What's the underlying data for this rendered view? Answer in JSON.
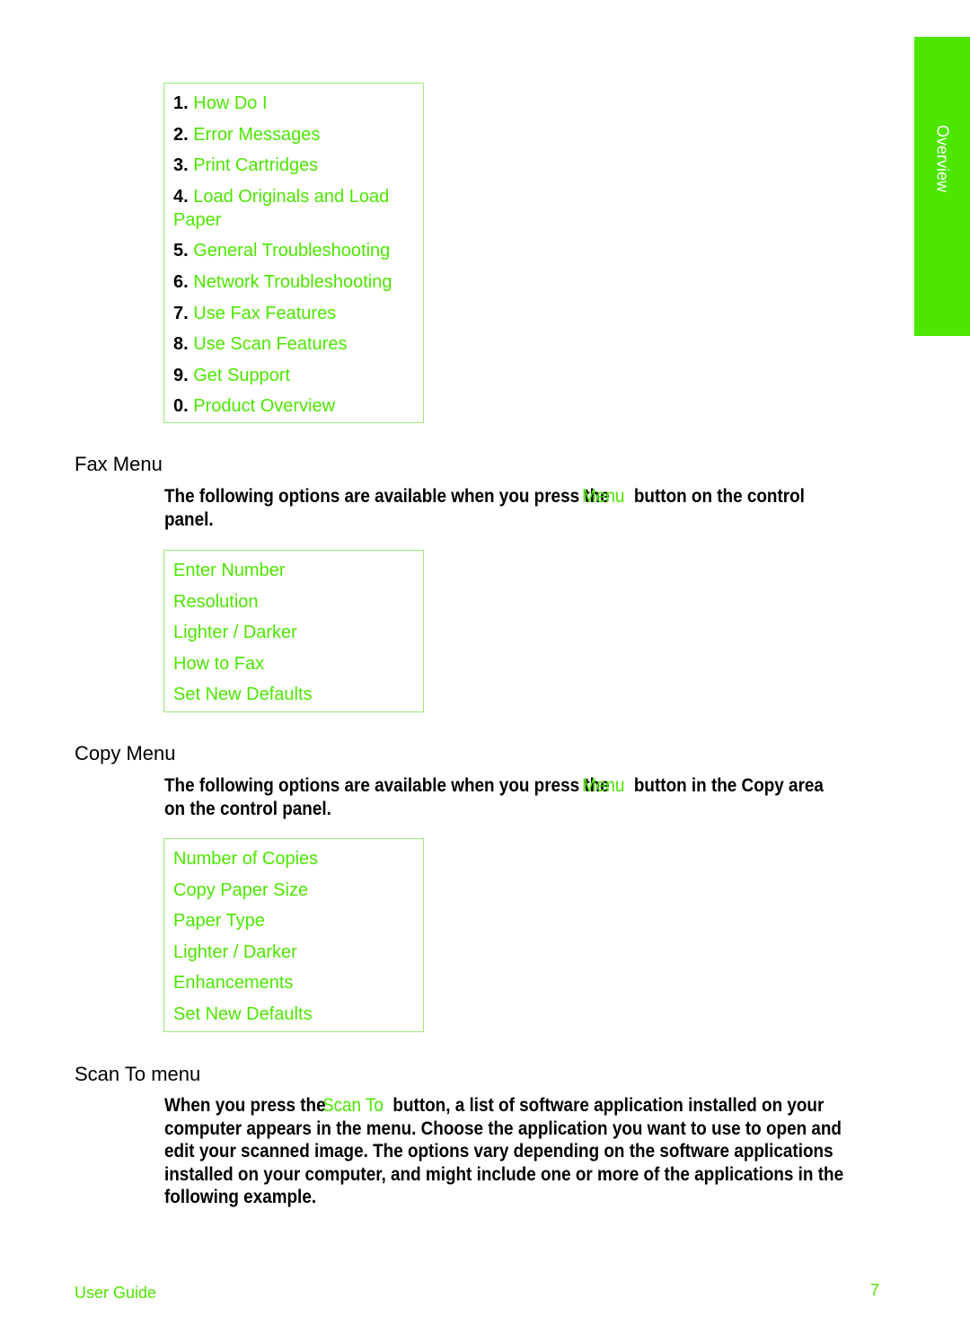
{
  "side_tab": {
    "label": "Overview"
  },
  "contents_menu": {
    "items": [
      {
        "num": "1.",
        "label": "How Do I"
      },
      {
        "num": "2.",
        "label": "Error Messages"
      },
      {
        "num": "3.",
        "label": "Print Cartridges"
      },
      {
        "num": "4.",
        "label": "Load Originals and Load Paper"
      },
      {
        "num": "5.",
        "label": "General Troubleshooting"
      },
      {
        "num": "6.",
        "label": "Network Troubleshooting"
      },
      {
        "num": "7.",
        "label": "Use Fax Features"
      },
      {
        "num": "8.",
        "label": "Use Scan Features"
      },
      {
        "num": "9.",
        "label": "Get Support"
      },
      {
        "num": "0.",
        "label": "Product Overview"
      }
    ]
  },
  "fax_menu": {
    "title": "Fax Menu",
    "line1_a": "The following options are available when you press the",
    "line1_kw": "Menu",
    "line1_b": "button on the control",
    "line2": "panel.",
    "items": [
      "Enter Number",
      "Resolution",
      "Lighter / Darker",
      "How to Fax",
      "Set New Defaults"
    ]
  },
  "copy_menu": {
    "title": "Copy Menu",
    "line1_a": "The following options are available when you press the",
    "line1_kw": "Menu",
    "line1_b": "button in the Copy area",
    "line2": "on the control panel.",
    "items": [
      "Number of Copies",
      "Copy Paper Size",
      "Paper Type",
      "Lighter / Darker",
      "Enhancements",
      "Set New Defaults"
    ]
  },
  "scan_menu": {
    "title": "Scan To menu",
    "line1_a": "When you press the",
    "line1_kw": "Scan To",
    "line1_b": "button, a list of software application installed on your",
    "lines": [
      "computer appears in the menu. Choose the application you want to use to open and",
      "edit your scanned image. The options vary depending on the software applications",
      "installed on your computer, and might include one or more of the applications in the",
      "following example."
    ]
  },
  "footer": {
    "guide": "User Guide",
    "page": "7"
  },
  "colors": {
    "accent": "#4ce600",
    "border": "#9de87a"
  }
}
